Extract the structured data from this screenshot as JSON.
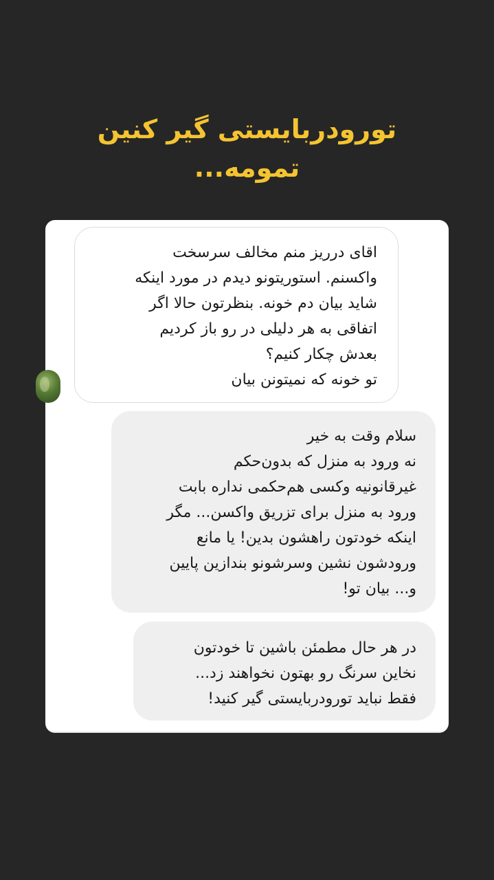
{
  "story": {
    "title_line1": "تورودربایستی گیر کنین",
    "title_line2": "تمومه..."
  },
  "conversation": {
    "incoming": {
      "lines": [
        "اقای درریز منم مخالف سرسخت",
        "واکسنم. استوریتونو دیدم در مورد اینکه",
        "شاید بیان دم خونه. بنظرتون حالا اگر",
        "اتفاقی به هر دلیلی در رو باز کردیم",
        "بعدش چکار کنیم؟",
        "تو خونه که نمیتونن بیان"
      ]
    },
    "reply_1": {
      "lines": [
        "سلام وقت به خیر",
        "نه ورود به منزل که بدون‌حکم",
        "غیرقانونیه وکسی هم‌حکمی نداره بابت",
        "ورود به منزل برای تزریق واکسن... مگر",
        "اینکه خودتون راهشون بدین! یا مانع",
        "ورودشون نشین وسرشونو بندازین پایین",
        "و... بیان تو!"
      ]
    },
    "reply_2": {
      "lines": [
        "در هر حال مطمئن باشین تا خودتون",
        "نخاین سرنگ رو بهتون نخواهند زد...",
        "فقط نباید تورودربایستی گیر کنید!"
      ]
    }
  },
  "colors": {
    "background": "#262626",
    "title": "#f4c431",
    "card": "#ffffff",
    "reply_bubble": "#efefef",
    "incoming_border": "#dcdcdc",
    "text": "#1a1a1a"
  }
}
